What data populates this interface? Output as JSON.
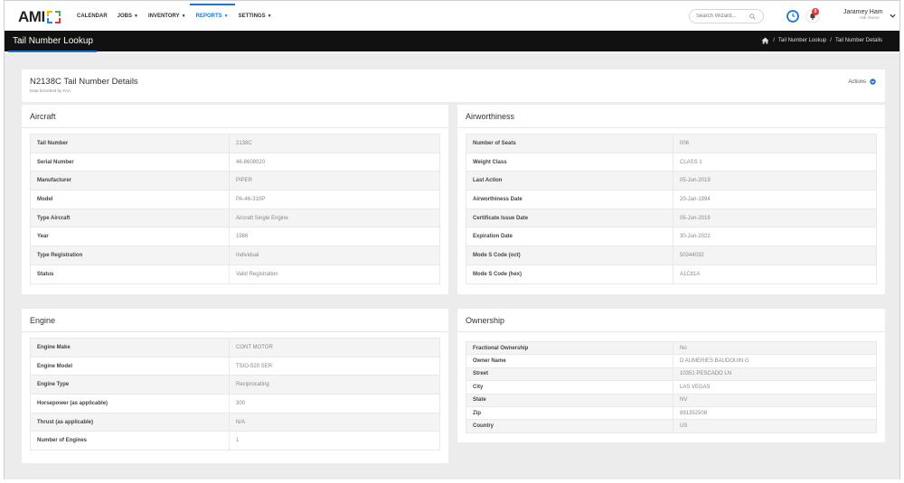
{
  "logo": {
    "text": "AMI"
  },
  "nav": {
    "items": [
      {
        "label": "CALENDAR",
        "dropdown": false,
        "active": false
      },
      {
        "label": "JOBS",
        "dropdown": true,
        "active": false
      },
      {
        "label": "INVENTORY",
        "dropdown": true,
        "active": false
      },
      {
        "label": "REPORTS",
        "dropdown": true,
        "active": true
      },
      {
        "label": "SETTINGS",
        "dropdown": true,
        "active": false
      }
    ]
  },
  "search": {
    "placeholder": "Search Wizard..."
  },
  "notifications": {
    "count": "0"
  },
  "user": {
    "name": "Jaramey Ham",
    "role": "AMI Owner"
  },
  "page": {
    "title": "Tail Number Lookup",
    "breadcrumb": [
      "Tail Number Lookup",
      "Tail Number Details"
    ]
  },
  "details": {
    "title": "N2138C Tail Number Details",
    "subtitle": "Data furnished by FAA",
    "actions_label": "Actions"
  },
  "aircraft": {
    "title": "Aircraft",
    "rows": [
      {
        "key": "Tail Number",
        "value": "2138C"
      },
      {
        "key": "Serial Number",
        "value": "46-8608020"
      },
      {
        "key": "Manufacturer",
        "value": "PIPER"
      },
      {
        "key": "Model",
        "value": "PA-46-310P"
      },
      {
        "key": "Type Aircraft",
        "value": "Aircraft Single Engine"
      },
      {
        "key": "Year",
        "value": "1986"
      },
      {
        "key": "Type Registration",
        "value": "Individual"
      },
      {
        "key": "Status",
        "value": "Valid Registration"
      }
    ]
  },
  "airworthiness": {
    "title": "Airworthiness",
    "rows": [
      {
        "key": "Number of Seats",
        "value": "006"
      },
      {
        "key": "Weight Class",
        "value": "CLASS 1"
      },
      {
        "key": "Last Action",
        "value": "05-Jun-2019"
      },
      {
        "key": "Airworthiness Date",
        "value": "20-Jan-1994"
      },
      {
        "key": "Certificate Issue Date",
        "value": "05-Jun-2019"
      },
      {
        "key": "Expiration Date",
        "value": "30-Jun-2022"
      },
      {
        "key": "Mode S Code (oct)",
        "value": "50344032"
      },
      {
        "key": "Mode S Code (hex)",
        "value": "A1C81A"
      }
    ]
  },
  "engine": {
    "title": "Engine",
    "rows": [
      {
        "key": "Engine Make",
        "value": "CONT MOTOR"
      },
      {
        "key": "Engine Model",
        "value": "TSIO-520 SER"
      },
      {
        "key": "Engine Type",
        "value": "Reciprocating"
      },
      {
        "key": "Horsepower (as applicable)",
        "value": "300"
      },
      {
        "key": "Thrust (as applicable)",
        "value": "N/A"
      },
      {
        "key": "Number of Engines",
        "value": "1"
      }
    ]
  },
  "ownership": {
    "title": "Ownership",
    "rows": [
      {
        "key": "Fractional Ownership",
        "value": "No"
      },
      {
        "key": "Owner Name",
        "value": "D AUMERIES BAUDOUIN G"
      },
      {
        "key": "Street",
        "value": "10351 PESCADO LN"
      },
      {
        "key": "City",
        "value": "LAS VEGAS"
      },
      {
        "key": "State",
        "value": "NV"
      },
      {
        "key": "Zip",
        "value": "891352508"
      },
      {
        "key": "Country",
        "value": "US"
      }
    ]
  },
  "colors": {
    "accent": "#1976d2",
    "titlebar": "#111111",
    "badge": "#e53935",
    "background": "#ececec"
  }
}
